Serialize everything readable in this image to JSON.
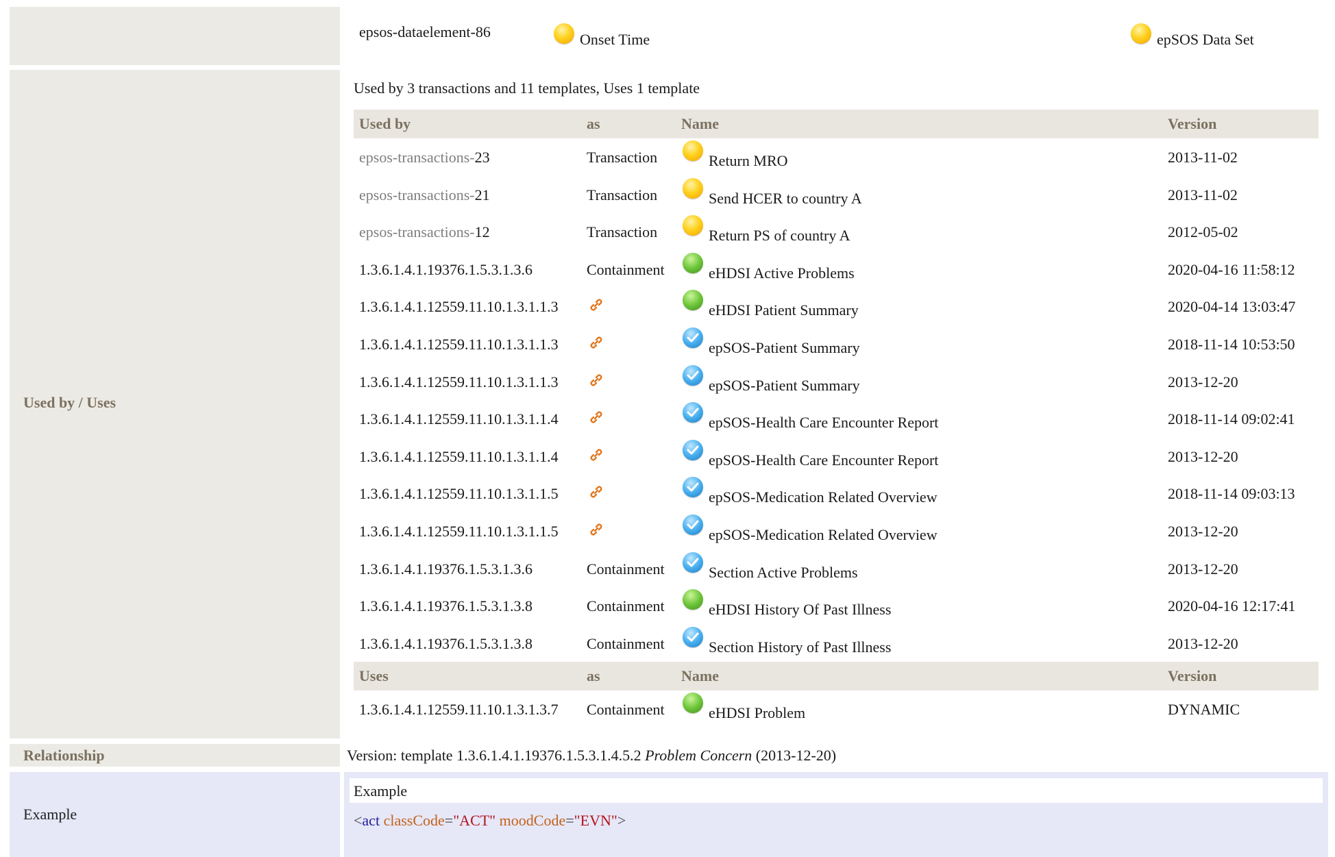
{
  "top_row": {
    "id": "epsos-dataelement-86",
    "concept": "Onset Time",
    "dataset": "epSOS Data Set"
  },
  "used_by_uses": {
    "label": "Used by / Uses",
    "summary": "Used by 3 transactions and 11 templates, Uses 1 template",
    "used_by_header": {
      "col1": "Used by",
      "col2": "as",
      "col3": "Name",
      "col4": "Version"
    },
    "used_by_rows": [
      {
        "id_prefix": "epsos-transactions-",
        "id_num": "23",
        "as": "Transaction",
        "icon": "yellow-circle-icon",
        "name": "Return MRO",
        "version": "2013-11-02"
      },
      {
        "id_prefix": "epsos-transactions-",
        "id_num": "21",
        "as": "Transaction",
        "icon": "yellow-circle-icon",
        "name": "Send HCER to country A",
        "version": "2013-11-02"
      },
      {
        "id_prefix": "epsos-transactions-",
        "id_num": "12",
        "as": "Transaction",
        "icon": "yellow-circle-icon",
        "name": "Return PS of country A",
        "version": "2012-05-02"
      },
      {
        "id": "1.3.6.1.4.1.19376.1.5.3.1.3.6",
        "as": "Containment",
        "icon": "green-circle-icon",
        "name": "eHDSI Active Problems",
        "version": "2020-04-16 11:58:12"
      },
      {
        "id": "1.3.6.1.4.1.12559.11.10.1.3.1.1.3",
        "as": "",
        "as_icon": "link-icon",
        "icon": "green-circle-icon",
        "name": "eHDSI Patient Summary",
        "version": "2020-04-14 13:03:47"
      },
      {
        "id": "1.3.6.1.4.1.12559.11.10.1.3.1.1.3",
        "as": "",
        "as_icon": "link-icon",
        "icon": "blue-check-icon",
        "name": "epSOS-Patient Summary",
        "version": "2018-11-14 10:53:50"
      },
      {
        "id": "1.3.6.1.4.1.12559.11.10.1.3.1.1.3",
        "as": "",
        "as_icon": "link-icon",
        "icon": "blue-check-icon",
        "name": "epSOS-Patient Summary",
        "version": "2013-12-20"
      },
      {
        "id": "1.3.6.1.4.1.12559.11.10.1.3.1.1.4",
        "as": "",
        "as_icon": "link-icon",
        "icon": "blue-check-icon",
        "name": "epSOS-Health Care Encounter Report",
        "version": "2018-11-14 09:02:41"
      },
      {
        "id": "1.3.6.1.4.1.12559.11.10.1.3.1.1.4",
        "as": "",
        "as_icon": "link-icon",
        "icon": "blue-check-icon",
        "name": "epSOS-Health Care Encounter Report",
        "version": "2013-12-20"
      },
      {
        "id": "1.3.6.1.4.1.12559.11.10.1.3.1.1.5",
        "as": "",
        "as_icon": "link-icon",
        "icon": "blue-check-icon",
        "name": "epSOS-Medication Related Overview",
        "version": "2018-11-14 09:03:13"
      },
      {
        "id": "1.3.6.1.4.1.12559.11.10.1.3.1.1.5",
        "as": "",
        "as_icon": "link-icon",
        "icon": "blue-check-icon",
        "name": "epSOS-Medication Related Overview",
        "version": "2013-12-20"
      },
      {
        "id": "1.3.6.1.4.1.19376.1.5.3.1.3.6",
        "as": "Containment",
        "icon": "blue-check-icon",
        "name": "Section Active Problems",
        "version": "2013-12-20"
      },
      {
        "id": "1.3.6.1.4.1.19376.1.5.3.1.3.8",
        "as": "Containment",
        "icon": "green-circle-icon",
        "name": "eHDSI History Of Past Illness",
        "version": "2020-04-16 12:17:41"
      },
      {
        "id": "1.3.6.1.4.1.19376.1.5.3.1.3.8",
        "as": "Containment",
        "icon": "blue-check-icon",
        "name": "Section History of Past Illness",
        "version": "2013-12-20"
      }
    ],
    "uses_header": {
      "col1": "Uses",
      "col2": "as",
      "col3": "Name",
      "col4": "Version"
    },
    "uses_rows": [
      {
        "id": "1.3.6.1.4.1.12559.11.10.1.3.1.3.7",
        "as": "Containment",
        "icon": "green-circle-icon",
        "name": "eHDSI Problem",
        "version": "DYNAMIC"
      }
    ]
  },
  "relationship": {
    "label": "Relationship",
    "prefix": "Version: template 1.3.6.1.4.1.19376.1.5.3.1.4.5.2 ",
    "template_name": "Problem Concern",
    "suffix": " (2013-12-20)"
  },
  "example": {
    "label": "Example",
    "heading": "Example",
    "code": {
      "open": "<",
      "element": "act",
      "attr1": "classCode",
      "val1": "\"ACT\"",
      "attr2": "moodCode",
      "val2": "\"EVN\"",
      "close": ">"
    }
  },
  "colors": {
    "label_brown": "#7b715f",
    "cell_grey": "#eceae5",
    "example_blue": "#e6e7f7",
    "xml_element": "#1e1e9c",
    "xml_attribute": "#c4621a",
    "xml_value": "#b2141e"
  }
}
